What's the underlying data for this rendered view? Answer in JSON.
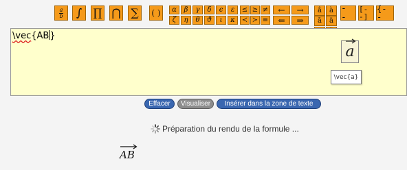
{
  "toolbar": {
    "big_buttons": [
      "∫",
      "∏",
      "⋂",
      "∑",
      "( )"
    ],
    "fraction": {
      "numerator": "a",
      "denominator": "b"
    },
    "greek_row1": [
      "α",
      "β",
      "γ",
      "δ",
      "ϵ",
      "ε"
    ],
    "greek_row2": [
      "ζ",
      "η",
      "θ",
      "ϑ",
      "ι",
      "κ"
    ],
    "relations_row1": [
      "≤",
      "≥",
      "≠"
    ],
    "relations_row2": [
      "≺",
      "≻",
      "≡"
    ],
    "arrows_row1": [
      "←",
      "→"
    ],
    "arrows_row2": [
      "⇐",
      "⇒"
    ],
    "accents": [
      "â",
      "à",
      "ā",
      "ä",
      "ã",
      "ǎ",
      "ȧ",
      "å",
      "ă",
      "ä̃"
    ],
    "matrix_buttons": [
      "- -",
      "[- -]",
      "{- -"
    ]
  },
  "editor": {
    "command": "\\vec",
    "argument": "AB"
  },
  "preview": {
    "symbol": "a",
    "tooltip": "\\vec{a}"
  },
  "actions": {
    "clear": "Effacer",
    "visualize": "Visualiser",
    "insert": "Insérer dans la zone de texte"
  },
  "status": {
    "message": "Préparation du rendu de la formule ..."
  },
  "render": {
    "formula": "AB"
  },
  "colors": {
    "button_orange": "#f59a1a",
    "editor_bg": "#ffffcc",
    "action_blue": "#3a67b0"
  }
}
